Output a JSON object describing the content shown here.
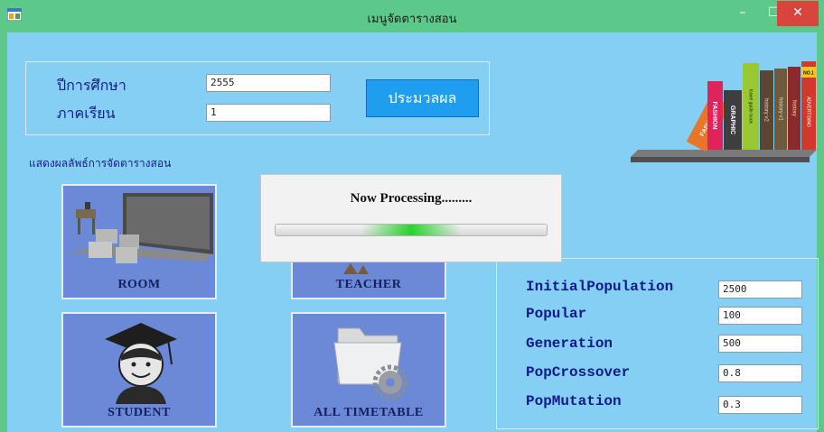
{
  "window": {
    "title": "เมนูจัดตารางสอน",
    "min_glyph": "–",
    "max_glyph": "☐",
    "close_glyph": "✕"
  },
  "form": {
    "year_label": "ปีการศึกษา",
    "year_value": "2555",
    "semester_label": "ภาคเรียน",
    "semester_value": "1",
    "process_label": "ประมวลผล"
  },
  "result_label": "แสดงผลลัพธ์การจัดตารางสอน",
  "tiles": {
    "room": "ROOM",
    "teacher": "TEACHER",
    "student": "STUDENT",
    "all": "ALL TIMETABLE"
  },
  "params": [
    {
      "label": "InitialPopulation",
      "value": "2500"
    },
    {
      "label": "Popular",
      "value": "100"
    },
    {
      "label": "Generation",
      "value": "500"
    },
    {
      "label": "PopCrossover",
      "value": "0.8"
    },
    {
      "label": "PopMutation",
      "value": "0.3"
    }
  ],
  "books": [
    "FASHION",
    "FASHION",
    "GRAPHIC",
    "travel guide book",
    "history v2",
    "history v1",
    "history",
    "ADVERTISING",
    "NO.1"
  ],
  "dialog": {
    "text": "Now Processing.........",
    "progress_marquee": 0.5
  },
  "icons": {
    "app": "app-window-icon",
    "room": "classroom-icon",
    "teacher": "teacher-icon",
    "student": "graduate-icon",
    "all": "folder-gear-icon",
    "books": "books-shelf-icon"
  },
  "colors": {
    "titlebar": "#5cc88a",
    "client": "#85cef4",
    "process_button": "#1f9ef0",
    "tile": "#6b89d6",
    "close_button": "#d9443c",
    "progress_glow": "#29d42e"
  }
}
